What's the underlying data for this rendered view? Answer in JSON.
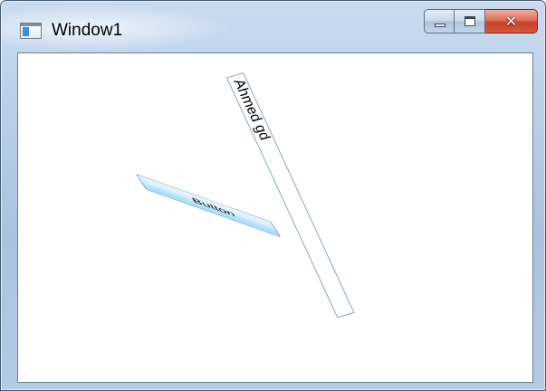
{
  "window": {
    "title": "Window1"
  },
  "controls": {
    "button_label": "Button",
    "textbox_value": "Ahmed gd"
  },
  "icons": {
    "app": "window-app-icon",
    "minimize": "minimize-icon",
    "maximize": "maximize-icon",
    "close": "close-icon"
  },
  "colors": {
    "close_button": "#c4432c",
    "button_fill": "#bee6fd",
    "button_border": "#3c7fb1",
    "client_background": "#ffffff"
  }
}
